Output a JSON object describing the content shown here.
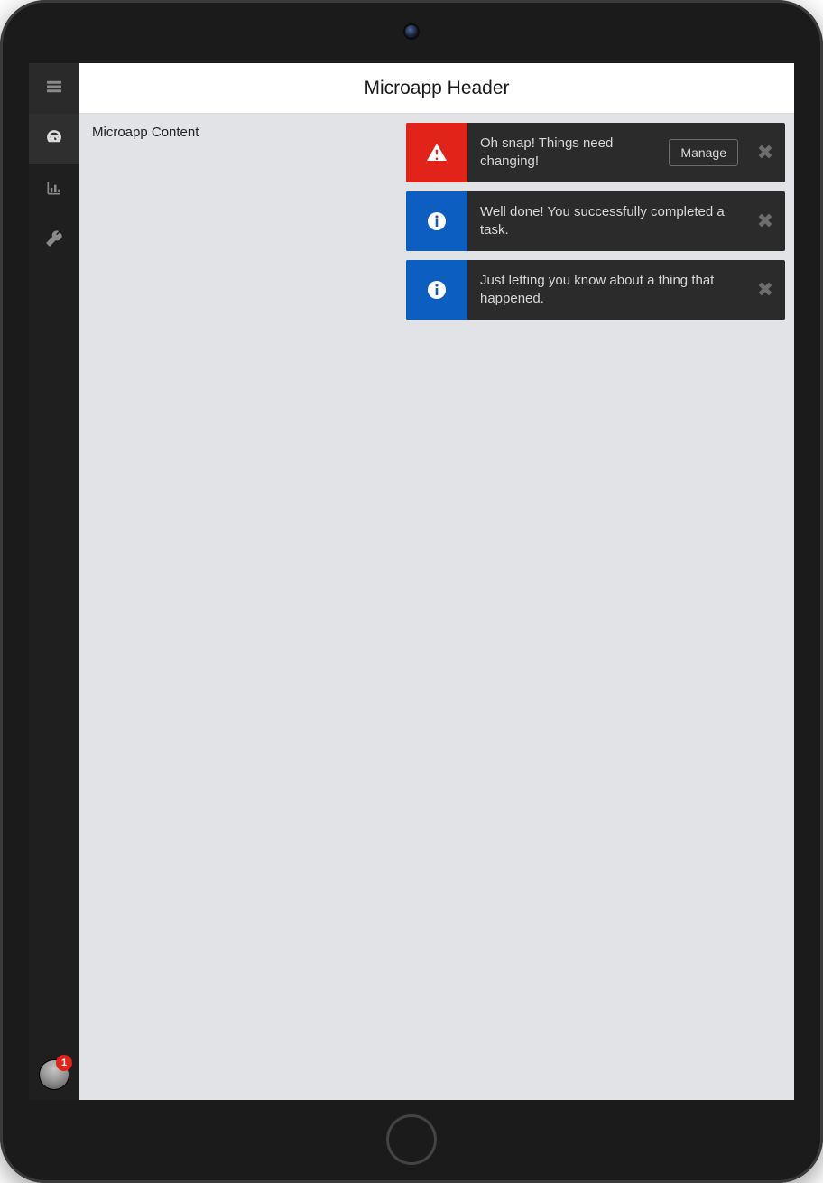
{
  "header": {
    "title": "Microapp Header"
  },
  "content": {
    "text": "Microapp Content"
  },
  "sidebar": {
    "hamburger_icon": "menu-icon",
    "items": [
      {
        "icon": "dashboard-icon",
        "active": true
      },
      {
        "icon": "bar-chart-icon",
        "active": false
      },
      {
        "icon": "wrench-icon",
        "active": false
      }
    ],
    "avatar_badge": "1"
  },
  "toasts": [
    {
      "level": "error",
      "icon": "warning-triangle-icon",
      "message": "Oh snap! Things need changing!",
      "action_label": "Manage"
    },
    {
      "level": "info",
      "icon": "info-circle-icon",
      "message": "Well done! You successfully completed a task."
    },
    {
      "level": "info",
      "icon": "info-circle-icon",
      "message": "Just letting you know about a thing that happened."
    }
  ]
}
